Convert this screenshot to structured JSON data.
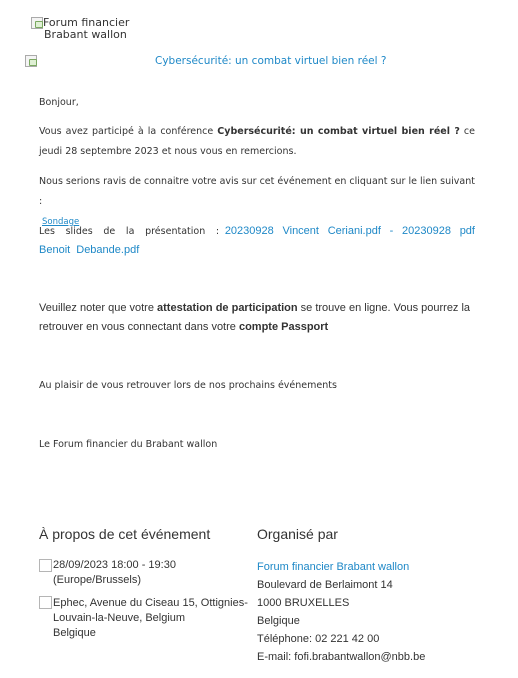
{
  "header": {
    "logo_alt_line1": "Forum financier",
    "logo_alt_line2": "Brabant wallon",
    "banner_title": "Cybersécurité: un combat virtuel bien réel ?"
  },
  "body": {
    "greeting": "Bonjour,",
    "p1_before": "Vous avez participé à la conférence ",
    "p1_bold": "Cybersécurité: un combat virtuel bien réel ?",
    "p1_after": " ce jeudi 28 septembre 2023 et nous vous en remercions.",
    "p2_text": "Nous serions ravis de connaitre votre avis sur cet événement en cliquant sur le lien suivant :",
    "p2_link": "Sondage",
    "p3_label": "Les slides de la présentation :",
    "p3_link": "20230928 Vincent Ceriani.pdf - 20230928 pdf Benoit Debande.pdf",
    "p4_a": "Veuillez noter que votre ",
    "p4_b": "attestation de participation",
    "p4_c": " se trouve en ligne. Vous pourrez la retrouver en vous connectant dans votre ",
    "p4_d": "compte Passport",
    "p5": "Au plaisir de vous retrouver lors de nos prochains événements",
    "signature": "Le Forum financier du Brabant wallon"
  },
  "event": {
    "heading": "À propos de cet événement",
    "date_line1": "28/09/2023 18:00 - 19:30",
    "date_line2": "(Europe/Brussels)",
    "location_line1": "Ephec, Avenue du Ciseau 15, Ottignies-",
    "location_line2": "Louvain-la-Neuve, Belgium",
    "location_line3": "Belgique"
  },
  "organizer": {
    "heading": "Organisé par",
    "name": "Forum financier Brabant wallon",
    "address1": "Boulevard de Berlaimont 14",
    "address2": "1000 BRUXELLES",
    "country": "Belgique",
    "phone": "Téléphone: 02 221 42 00",
    "email": "E-mail: fofi.brabantwallon@nbb.be"
  }
}
